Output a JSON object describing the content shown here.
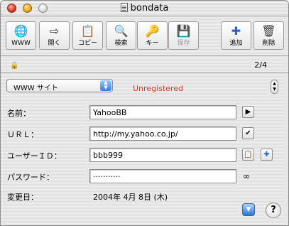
{
  "window": {
    "title": "bondata"
  },
  "toolbar": {
    "www": "WWW",
    "open": "開く",
    "copy": "コピー",
    "search": "検索",
    "key": "キー",
    "save": "保存",
    "add": "追加",
    "delete": "削除"
  },
  "record": {
    "position": "2/4",
    "locked": true
  },
  "category": {
    "selected": "WWW サイト"
  },
  "status": {
    "text": "Unregistered",
    "color": "#d93a2a"
  },
  "fields": {
    "name_label": "名前：",
    "name_value": "YahooBB",
    "url_label": "ＵＲＬ：",
    "url_value": "http://my.yahoo.co.jp/",
    "userid_label": "ユーザーＩＤ：",
    "userid_value": "bbb999",
    "password_label": "パスワード：",
    "password_value": "···········",
    "modified_label": "変更日：",
    "modified_value": "2004年 4月 8日 (木)"
  },
  "icons": {
    "globe": "🌐",
    "open": "⇨",
    "copy": "📋",
    "search": "🔍",
    "key": "🔑",
    "save": "💾",
    "add": "✚",
    "delete": "🗑",
    "lock": "🔒",
    "popup_arrows": "▲▼",
    "stepper_arrows": "▲▼",
    "play": "▶",
    "check": "✔",
    "clipboard": "📋",
    "plus": "✚",
    "glasses": "∞",
    "disclosure": "▼",
    "help": "?"
  },
  "colors": {
    "accent": "#2f7ee8"
  }
}
